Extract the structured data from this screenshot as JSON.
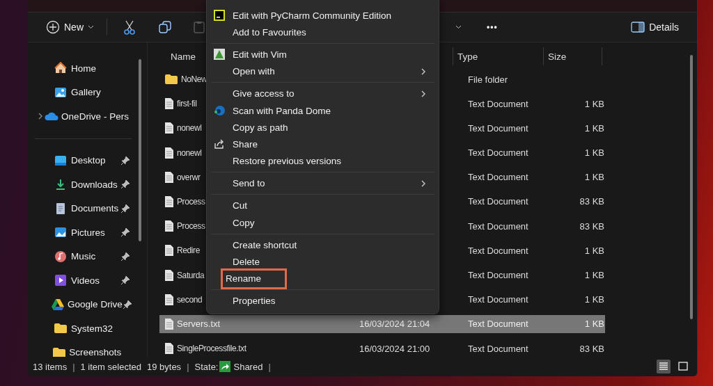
{
  "toolbar": {
    "new_label": "New",
    "more_label": "•••",
    "details_label": "Details",
    "paste_disabled": true
  },
  "sidebar": {
    "items": [
      {
        "label": "Home",
        "kind": "home",
        "pinned": false,
        "expandable": false,
        "divider_before": false
      },
      {
        "label": "Gallery",
        "kind": "gallery",
        "pinned": false,
        "expandable": false,
        "divider_before": false
      },
      {
        "label": "OneDrive - Pers",
        "kind": "cloud",
        "pinned": false,
        "expandable": true,
        "divider_before": false
      },
      {
        "label": "Desktop",
        "kind": "desktop",
        "pinned": true,
        "expandable": false,
        "divider_before": true
      },
      {
        "label": "Downloads",
        "kind": "download",
        "pinned": true,
        "expandable": false,
        "divider_before": false
      },
      {
        "label": "Documents",
        "kind": "documents",
        "pinned": true,
        "expandable": false,
        "divider_before": false
      },
      {
        "label": "Pictures",
        "kind": "pictures",
        "pinned": true,
        "expandable": false,
        "divider_before": false
      },
      {
        "label": "Music",
        "kind": "music",
        "pinned": true,
        "expandable": false,
        "divider_before": false
      },
      {
        "label": "Videos",
        "kind": "videos",
        "pinned": true,
        "expandable": false,
        "divider_before": false
      },
      {
        "label": "Google Drive",
        "kind": "drive",
        "pinned": true,
        "expandable": false,
        "divider_before": false
      },
      {
        "label": "System32",
        "kind": "folder",
        "pinned": false,
        "expandable": false,
        "divider_before": false
      },
      {
        "label": "Screenshots",
        "kind": "folder",
        "pinned": false,
        "expandable": false,
        "divider_before": false
      }
    ]
  },
  "file_list": {
    "columns": [
      {
        "label": "Name"
      },
      {
        "label": "Type"
      },
      {
        "label": "Size"
      }
    ],
    "rows": [
      {
        "kind": "folder",
        "name": "NoNew",
        "type": "File folder",
        "selected": false
      },
      {
        "kind": "file",
        "name": "first-fil",
        "type": "Text Document",
        "size": "1 KB",
        "selected": false
      },
      {
        "kind": "file",
        "name": "nonewl",
        "type": "Text Document",
        "size": "1 KB",
        "selected": false
      },
      {
        "kind": "file",
        "name": "nonewl",
        "type": "Text Document",
        "size": "1 KB",
        "selected": false
      },
      {
        "kind": "file",
        "name": "overwr",
        "type": "Text Document",
        "size": "1 KB",
        "selected": false
      },
      {
        "kind": "file",
        "name": "Process",
        "type": "Text Document",
        "size": "83 KB",
        "selected": false
      },
      {
        "kind": "file",
        "name": "Process",
        "type": "Text Document",
        "size": "83 KB",
        "selected": false
      },
      {
        "kind": "file",
        "name": "Redire",
        "type": "Text Document",
        "size": "1 KB",
        "selected": false
      },
      {
        "kind": "file",
        "name": "Saturda",
        "type": "Text Document",
        "size": "1 KB",
        "selected": false
      },
      {
        "kind": "file",
        "name": "second",
        "type": "Text Document",
        "size": "1 KB",
        "selected": false
      },
      {
        "kind": "file",
        "name": "Servers.txt",
        "date": "16/03/2024 21:04",
        "type": "Text Document",
        "size": "1 KB",
        "selected": true
      },
      {
        "kind": "file",
        "name": "SingleProcessfile.txt",
        "date": "16/03/2024 21:00",
        "type": "Text Document",
        "size": "83 KB",
        "selected": false
      }
    ]
  },
  "context_menu": {
    "groups": [
      [
        {
          "label": "Edit with PyCharm Community Edition",
          "submenu": false,
          "annotated": false
        },
        {
          "label": "Add to Favourites",
          "submenu": false,
          "annotated": false
        }
      ],
      [
        {
          "label": "Edit with Vim",
          "submenu": false,
          "annotated": false
        },
        {
          "label": "Open with",
          "submenu": true,
          "annotated": false
        }
      ],
      [
        {
          "label": "Give access to",
          "submenu": true,
          "annotated": false
        },
        {
          "label": "Scan with Panda Dome",
          "submenu": false,
          "annotated": false
        },
        {
          "label": "Copy as path",
          "submenu": false,
          "annotated": false
        },
        {
          "label": "Share",
          "submenu": false,
          "annotated": false
        },
        {
          "label": "Restore previous versions",
          "submenu": false,
          "annotated": false
        }
      ],
      [
        {
          "label": "Send to",
          "submenu": true,
          "annotated": false
        }
      ],
      [
        {
          "label": "Cut",
          "submenu": false,
          "annotated": false
        },
        {
          "label": "Copy",
          "submenu": false,
          "annotated": false
        }
      ],
      [
        {
          "label": "Create shortcut",
          "submenu": false,
          "annotated": false
        },
        {
          "label": "Delete",
          "submenu": false,
          "annotated": false
        },
        {
          "label": "Rename",
          "submenu": false,
          "annotated": true
        }
      ],
      [
        {
          "label": "Properties",
          "submenu": false,
          "annotated": false
        }
      ]
    ]
  },
  "status_bar": {
    "parts": [
      {
        "kind": "text",
        "text": "13 items"
      },
      {
        "kind": "separator",
        "text": "|"
      },
      {
        "kind": "text",
        "text": "1 item selected"
      },
      {
        "kind": "text",
        "text": "19 bytes"
      },
      {
        "kind": "separator",
        "text": "|"
      },
      {
        "kind": "text",
        "text": "State:"
      },
      {
        "kind": "shared_icon"
      },
      {
        "kind": "text",
        "text": "Shared"
      },
      {
        "kind": "separator",
        "text": "|"
      }
    ],
    "view_buttons": [
      {
        "kind": "details",
        "selected": true
      },
      {
        "kind": "tiles",
        "selected": false
      }
    ]
  }
}
